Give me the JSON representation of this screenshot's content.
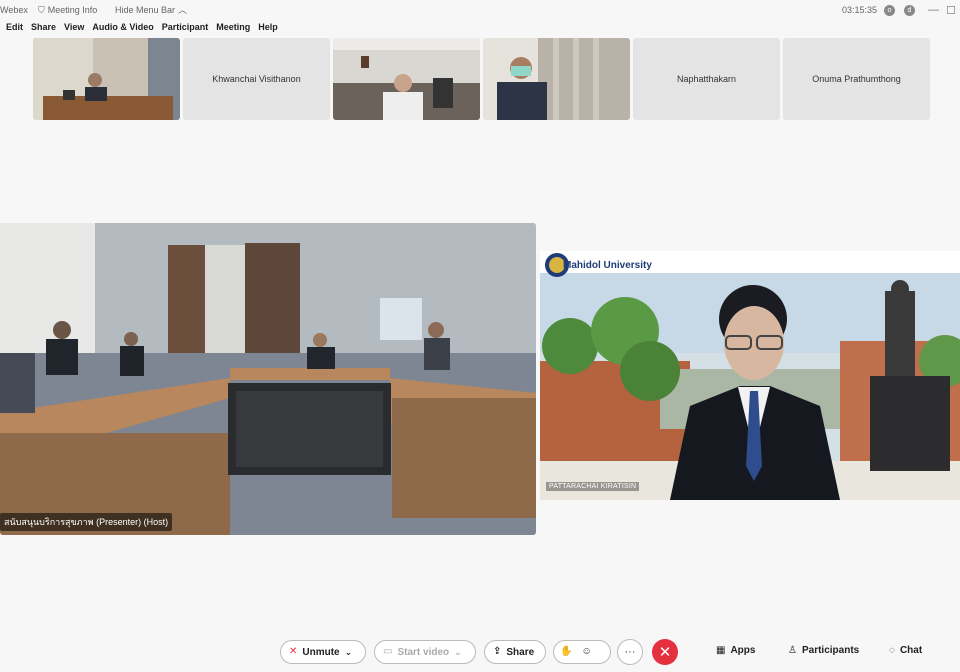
{
  "titlebar": {
    "app": "Webex",
    "meeting_info": "Meeting Info",
    "hide_menu": "Hide Menu Bar",
    "clock": "03:15:35",
    "avatar1": "o",
    "avatar2": "d",
    "minimize_glyph": "—",
    "maximize_glyph": "☐"
  },
  "menu": [
    "Edit",
    "Share",
    "View",
    "Audio & Video",
    "Participant",
    "Meeting",
    "Help"
  ],
  "thumbnails": [
    {
      "type": "video"
    },
    {
      "type": "name",
      "name": "Khwanchai Visithanon"
    },
    {
      "type": "video"
    },
    {
      "type": "video"
    },
    {
      "type": "name",
      "name": "Naphatthakarn"
    },
    {
      "type": "name",
      "name": "Onuma Prathumthong"
    }
  ],
  "main_video": {
    "name_label": "สนับสนุนบริการสุขภาพ (Presenter) (Host)"
  },
  "share_video": {
    "university": "Mahidol University",
    "person_label": "PATTARACHAI KIRATISIN"
  },
  "controls": {
    "unmute": "Unmute",
    "start_video": "Start video",
    "share": "Share",
    "more": "···",
    "leave": "✕",
    "apps": "Apps",
    "participants": "Participants",
    "chat": "Chat"
  },
  "icons": {
    "mic_muted": "🎙",
    "video_off": "📷",
    "share": "⬆",
    "hand": "✋",
    "emoji": "☺",
    "apps": "▦",
    "participants": "👤",
    "chat": "💬",
    "chevron": "⌄"
  }
}
